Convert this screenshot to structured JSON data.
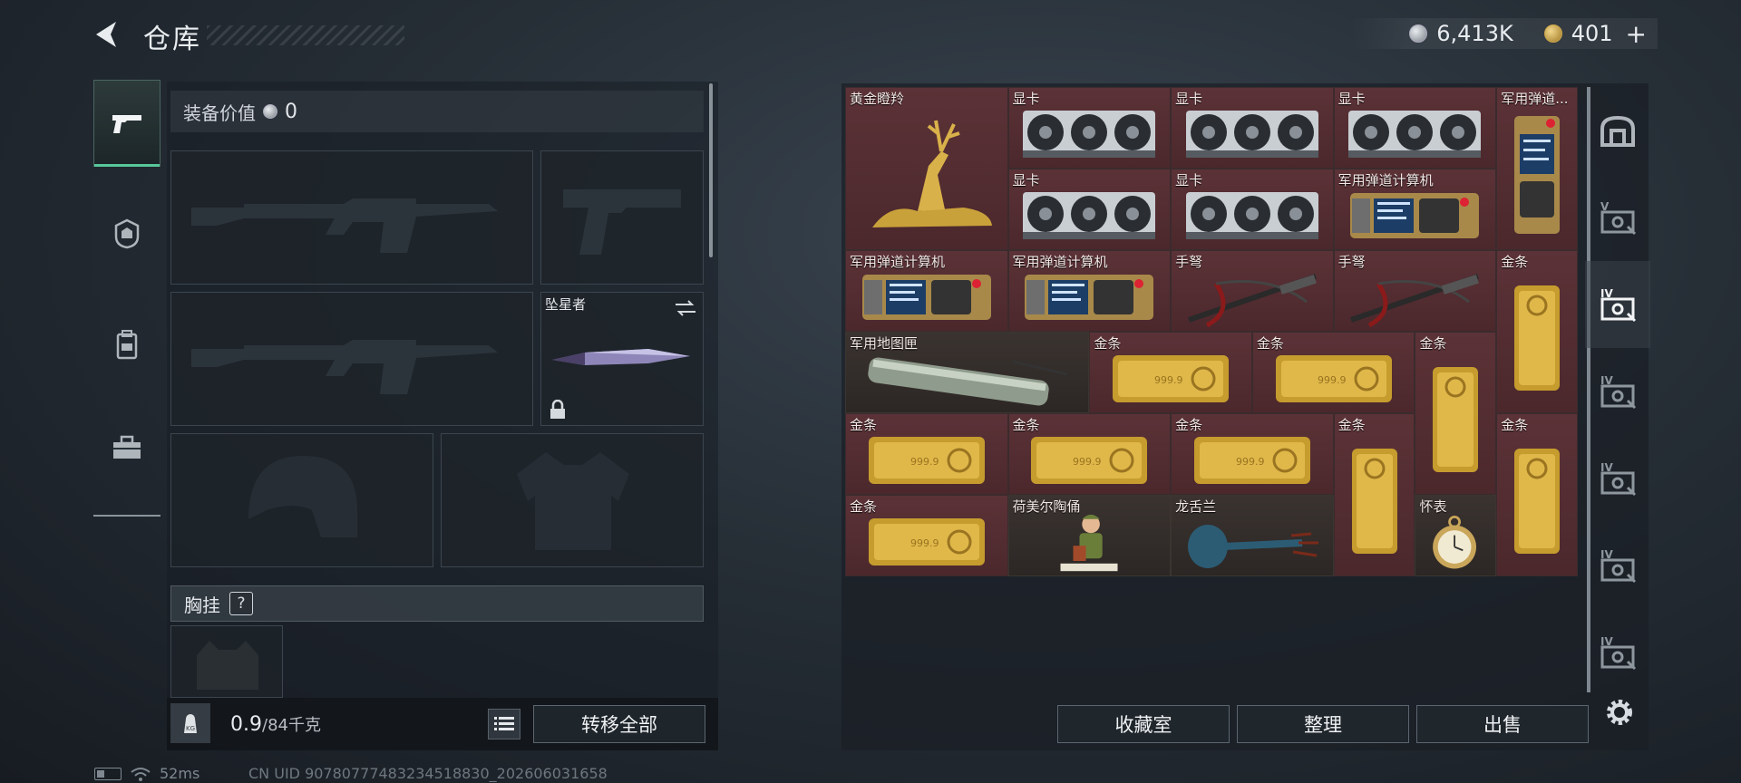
{
  "header": {
    "title": "仓库",
    "silver": "6,413K",
    "gold": "401",
    "plus": "+"
  },
  "loadout": {
    "equipment_value_label": "装备价值",
    "equipment_value": "0",
    "melee_name": "坠星者",
    "vest_label": "胸挂",
    "help": "?",
    "weight_current": "0.9",
    "weight_max": "/84千克",
    "transfer_all": "转移全部"
  },
  "stash": {
    "items": [
      {
        "label": "黄金瞪羚",
        "kind": "deer"
      },
      {
        "label": "显卡",
        "kind": "gpu"
      },
      {
        "label": "显卡",
        "kind": "gpu"
      },
      {
        "label": "显卡",
        "kind": "gpu"
      },
      {
        "label": "军用弹道...",
        "kind": "calc-v"
      },
      {
        "label": "显卡",
        "kind": "gpu"
      },
      {
        "label": "显卡",
        "kind": "gpu"
      },
      {
        "label": "军用弹道计算机",
        "kind": "calc"
      },
      {
        "label": "军用弹道计算机",
        "kind": "calc"
      },
      {
        "label": "军用弹道计算机",
        "kind": "calc"
      },
      {
        "label": "手弩",
        "kind": "crossbow"
      },
      {
        "label": "手弩",
        "kind": "crossbow"
      },
      {
        "label": "金条",
        "kind": "gold-v"
      },
      {
        "label": "军用地图匣",
        "kind": "tube"
      },
      {
        "label": "金条",
        "kind": "gold-h"
      },
      {
        "label": "金条",
        "kind": "gold-h"
      },
      {
        "label": "金条",
        "kind": "gold-v"
      },
      {
        "label": "金条",
        "kind": "gold-h"
      },
      {
        "label": "金条",
        "kind": "gold-h"
      },
      {
        "label": "金条",
        "kind": "gold-h"
      },
      {
        "label": "金条",
        "kind": "gold-v"
      },
      {
        "label": "金条",
        "kind": "gold-v"
      },
      {
        "label": "金条",
        "kind": "gold-h"
      },
      {
        "label": "荷美尔陶俑",
        "kind": "figurine"
      },
      {
        "label": "龙舌兰",
        "kind": "bottle"
      },
      {
        "label": "怀表",
        "kind": "watch"
      }
    ],
    "buttons": {
      "collection": "收藏室",
      "organize": "整理",
      "sell": "出售"
    },
    "side_tabs": [
      "V",
      "IV",
      "IV",
      "IV",
      "IV",
      "IV"
    ]
  },
  "status_bar": {
    "ping": "52ms",
    "uid": "CN UID 9078077748323451883​0_202606031658"
  },
  "colors": {
    "accent": "#58c89a",
    "item_bg": "#5b3237",
    "gold": "#c9a137"
  }
}
